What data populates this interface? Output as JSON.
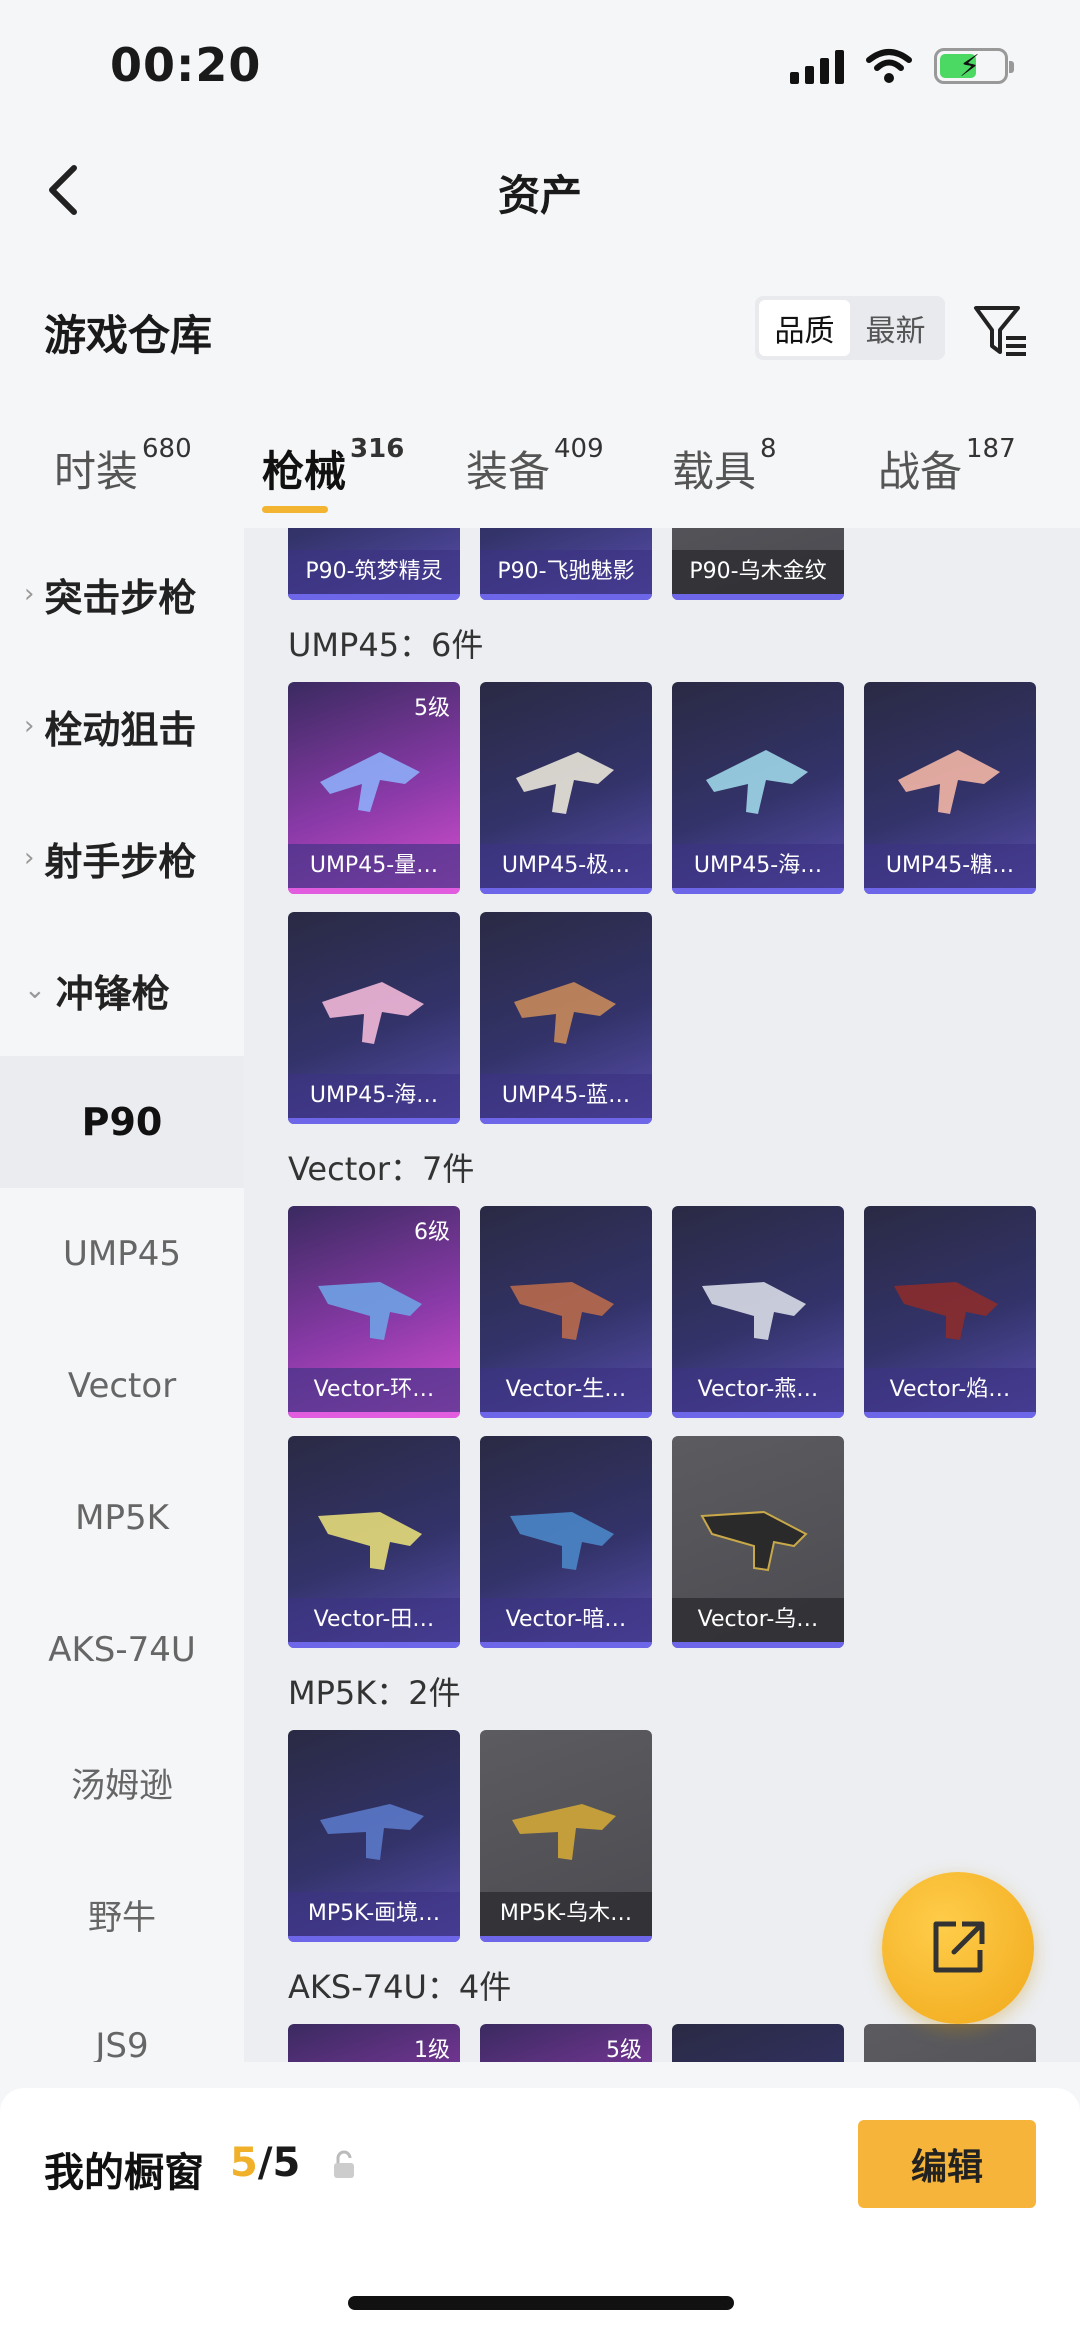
{
  "status_bar": {
    "time": "00:20"
  },
  "nav": {
    "title": "资产"
  },
  "store": {
    "title": "游戏仓库",
    "sort_quality": "品质",
    "sort_latest": "最新"
  },
  "tabs": [
    {
      "label": "时装",
      "count": "680"
    },
    {
      "label": "枪械",
      "count": "316"
    },
    {
      "label": "装备",
      "count": "409"
    },
    {
      "label": "载具",
      "count": "8"
    },
    {
      "label": "战备",
      "count": "187"
    }
  ],
  "sidebar": {
    "categories": [
      "突击步枪",
      "栓动狙击",
      "射手步枪",
      "冲锋枪"
    ],
    "subitems": [
      "P90",
      "UMP45",
      "Vector",
      "MP5K",
      "AKS-74U",
      "汤姆逊",
      "野牛",
      "JS9"
    ]
  },
  "groups": {
    "p90": {
      "items": [
        "P90-筑梦精灵",
        "P90-飞驰魅影",
        "P90-乌木金纹"
      ]
    },
    "ump45": {
      "label": "UMP45：6件",
      "items": [
        "UMP45-量…",
        "UMP45-极…",
        "UMP45-海…",
        "UMP45-糖…",
        "UMP45-海…",
        "UMP45-蓝…"
      ],
      "level": "5级"
    },
    "vector": {
      "label": "Vector：7件",
      "items": [
        "Vector-环…",
        "Vector-生…",
        "Vector-燕…",
        "Vector-焰…",
        "Vector-田…",
        "Vector-暗…",
        "Vector-乌…"
      ],
      "level": "6级"
    },
    "mp5k": {
      "label": "MP5K：2件",
      "items": [
        "MP5K-画境…",
        "MP5K-乌木…"
      ]
    },
    "aks": {
      "label": "AKS-74U：4件",
      "level1": "1级",
      "level2": "5级"
    }
  },
  "bottom": {
    "showcase_label": "我的橱窗",
    "current": "5",
    "total": "/5",
    "edit_label": "编辑"
  }
}
